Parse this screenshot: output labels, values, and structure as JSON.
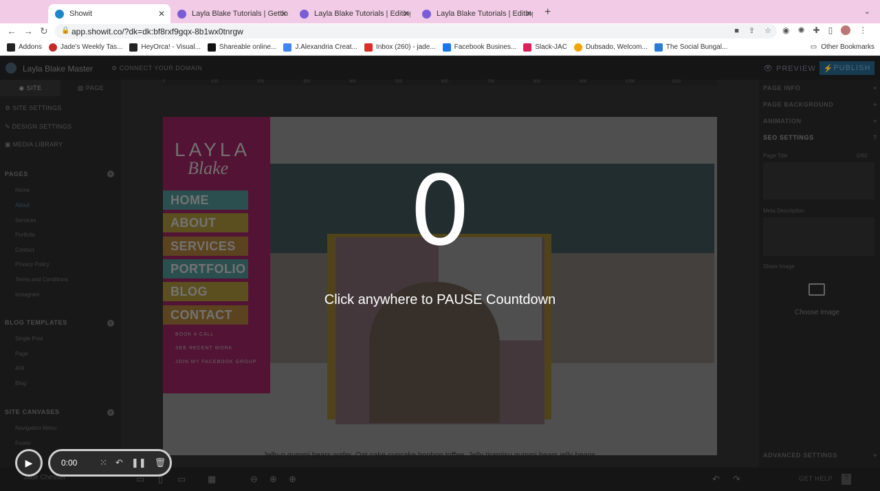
{
  "tabs": [
    {
      "title": "Showit",
      "icon_color": "#1a88c9"
    },
    {
      "title": "Layla Blake Tutorials | Getting",
      "icon_color": "#7a5cd6"
    },
    {
      "title": "Layla Blake Tutorials | Editing",
      "icon_color": "#7a5cd6"
    },
    {
      "title": "Layla Blake Tutorials | Editing",
      "icon_color": "#7a5cd6"
    }
  ],
  "address": {
    "url": "app.showit.co/?dk=dk:bf8rxf9gqx-8b1wx0tnrgw"
  },
  "bookmarks": [
    {
      "label": "Addons",
      "color": "#222"
    },
    {
      "label": "Jade's Weekly Tas...",
      "color": "#c62828"
    },
    {
      "label": "HeyOrca! - Visual...",
      "color": "#222"
    },
    {
      "label": "Shareable online...",
      "color": "#111"
    },
    {
      "label": "J.Alexandria Creat...",
      "color": "#4285f4"
    },
    {
      "label": "Inbox (260) - jade...",
      "color": "#d93025"
    },
    {
      "label": "Facebook Busines...",
      "color": "#1877f2"
    },
    {
      "label": "Slack-JAC",
      "color": "#e01e5a"
    },
    {
      "label": "Dubsado, Welcom...",
      "color": "#f4a300"
    },
    {
      "label": "The Social Bungal...",
      "color": "#2a7bd6"
    }
  ],
  "other_bookmarks": "Other Bookmarks",
  "app": {
    "site_name": "Layla Blake Master",
    "connect_domain": "CONNECT YOUR DOMAIN",
    "preview": "PREVIEW",
    "publish": "PUBLISH"
  },
  "left": {
    "tab_site": "SITE",
    "tab_page": "PAGE",
    "site_settings": "SITE SETTINGS",
    "design_settings": "DESIGN SETTINGS",
    "media_library": "MEDIA LIBRARY",
    "pages_header": "PAGES",
    "pages": [
      "Home",
      "About",
      "Services",
      "Portfolio",
      "Contact",
      "Privacy Policy",
      "Terms and Conditions",
      "Instagram"
    ],
    "blog_header": "BLOG TEMPLATES",
    "blog": [
      "Single Post",
      "Page",
      "404",
      "Blog"
    ],
    "canvases_header": "SITE CANVASES",
    "canvases": [
      "Navigation Menu",
      "Footer"
    ],
    "user": "Jade Chesser"
  },
  "ruler": [
    "0",
    "100",
    "200",
    "300",
    "400",
    "500",
    "600",
    "700",
    "800",
    "900",
    "1000",
    "1100"
  ],
  "page": {
    "brand_top": "LAYLA",
    "brand_bottom": "Blake",
    "menu": [
      {
        "label": "HOME",
        "color": "#3a6a6a"
      },
      {
        "label": "ABOUT",
        "color": "#7a6a2a"
      },
      {
        "label": "SERVICES",
        "color": "#7a5a2a"
      },
      {
        "label": "PORTFOLIO",
        "color": "#3a6a6a"
      },
      {
        "label": "BLOG",
        "color": "#7a6a2a"
      },
      {
        "label": "CONTACT",
        "color": "#7a5a2a"
      }
    ],
    "links": [
      "BOOK A CALL",
      "SEE RECENT WORK",
      "JOIN MY FACEBOOK GROUP"
    ],
    "body_text": "Jelly-o gummi bears wafer. Oat cake cupcake bonbon toffee. Jelly tiramisu gummi bears jelly beans"
  },
  "right": {
    "page_info": "PAGE INFO",
    "page_background": "PAGE BACKGROUND",
    "animation": "ANIMATION",
    "seo_settings": "SEO SETTINGS",
    "page_title_label": "Page Title",
    "page_title_count": "0/60",
    "meta_description": "Meta Description",
    "share_image": "Share Image",
    "choose_image": "Choose Image",
    "advanced_settings": "ADVANCED SETTINGS",
    "get_help": "GET HELP"
  },
  "overlay": {
    "countdown": "0",
    "message": "Click anywhere to PAUSE Countdown"
  },
  "recorder": {
    "time": "0:00"
  }
}
